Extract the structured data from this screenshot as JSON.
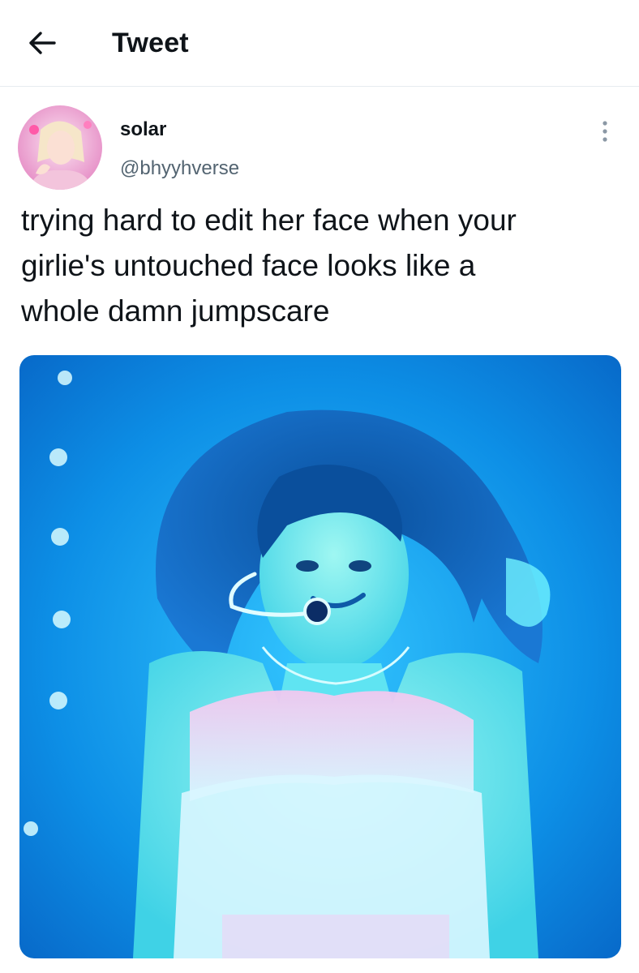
{
  "header": {
    "title": "Tweet",
    "back_icon": "arrow-left-icon"
  },
  "tweet": {
    "author": {
      "display_name": "solar",
      "handle": "@bhyyhverse"
    },
    "more_icon": "more-vertical-icon",
    "text": "trying hard to edit her face when your\ngirlie's untouched face looks like a\nwhole damn jumpscare"
  },
  "colors": {
    "text_primary": "#0f1419",
    "text_secondary": "#536471",
    "divider": "#e6ecf0",
    "media_blue": "#0a84e0"
  }
}
